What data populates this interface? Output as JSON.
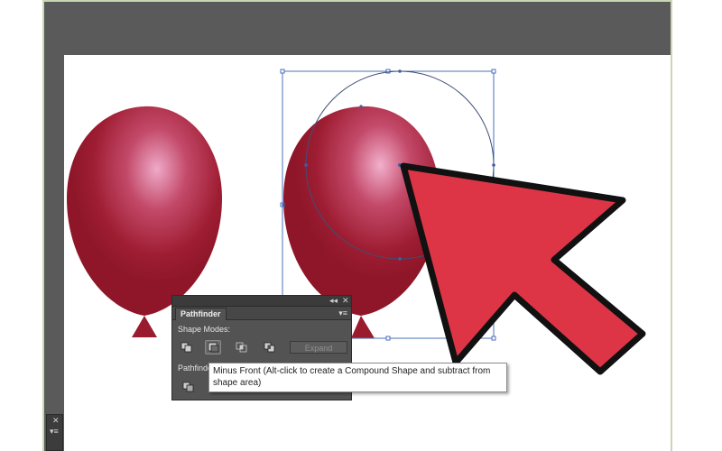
{
  "panel": {
    "collapse_glyph": "◂◂",
    "close_glyph": "✕",
    "tab_label": "Pathfinder",
    "menu_glyph": "▾≡",
    "shape_modes_label": "Shape Modes:",
    "expand_label": "Expand",
    "pathfinders_label": "Pathfinde",
    "mode_buttons": [
      {
        "name": "unite-icon"
      },
      {
        "name": "minus-front-icon",
        "active": true
      },
      {
        "name": "intersect-icon"
      },
      {
        "name": "exclude-icon"
      }
    ]
  },
  "tooltip": {
    "line1": "Minus Front (Alt-click to create a Compound Shape and subtract from",
    "line2": "shape area)"
  },
  "mini_panel": {
    "close_glyph": "✕",
    "menu_glyph": "▾≡"
  },
  "colors": {
    "balloon": "#9a1b2e",
    "balloon_highlight": "#e8a4c0",
    "arrow_fill": "#dd3545",
    "selection": "#4a6fb8",
    "panel_bg": "#535353",
    "canvas_bg": "#5a5a5a"
  }
}
